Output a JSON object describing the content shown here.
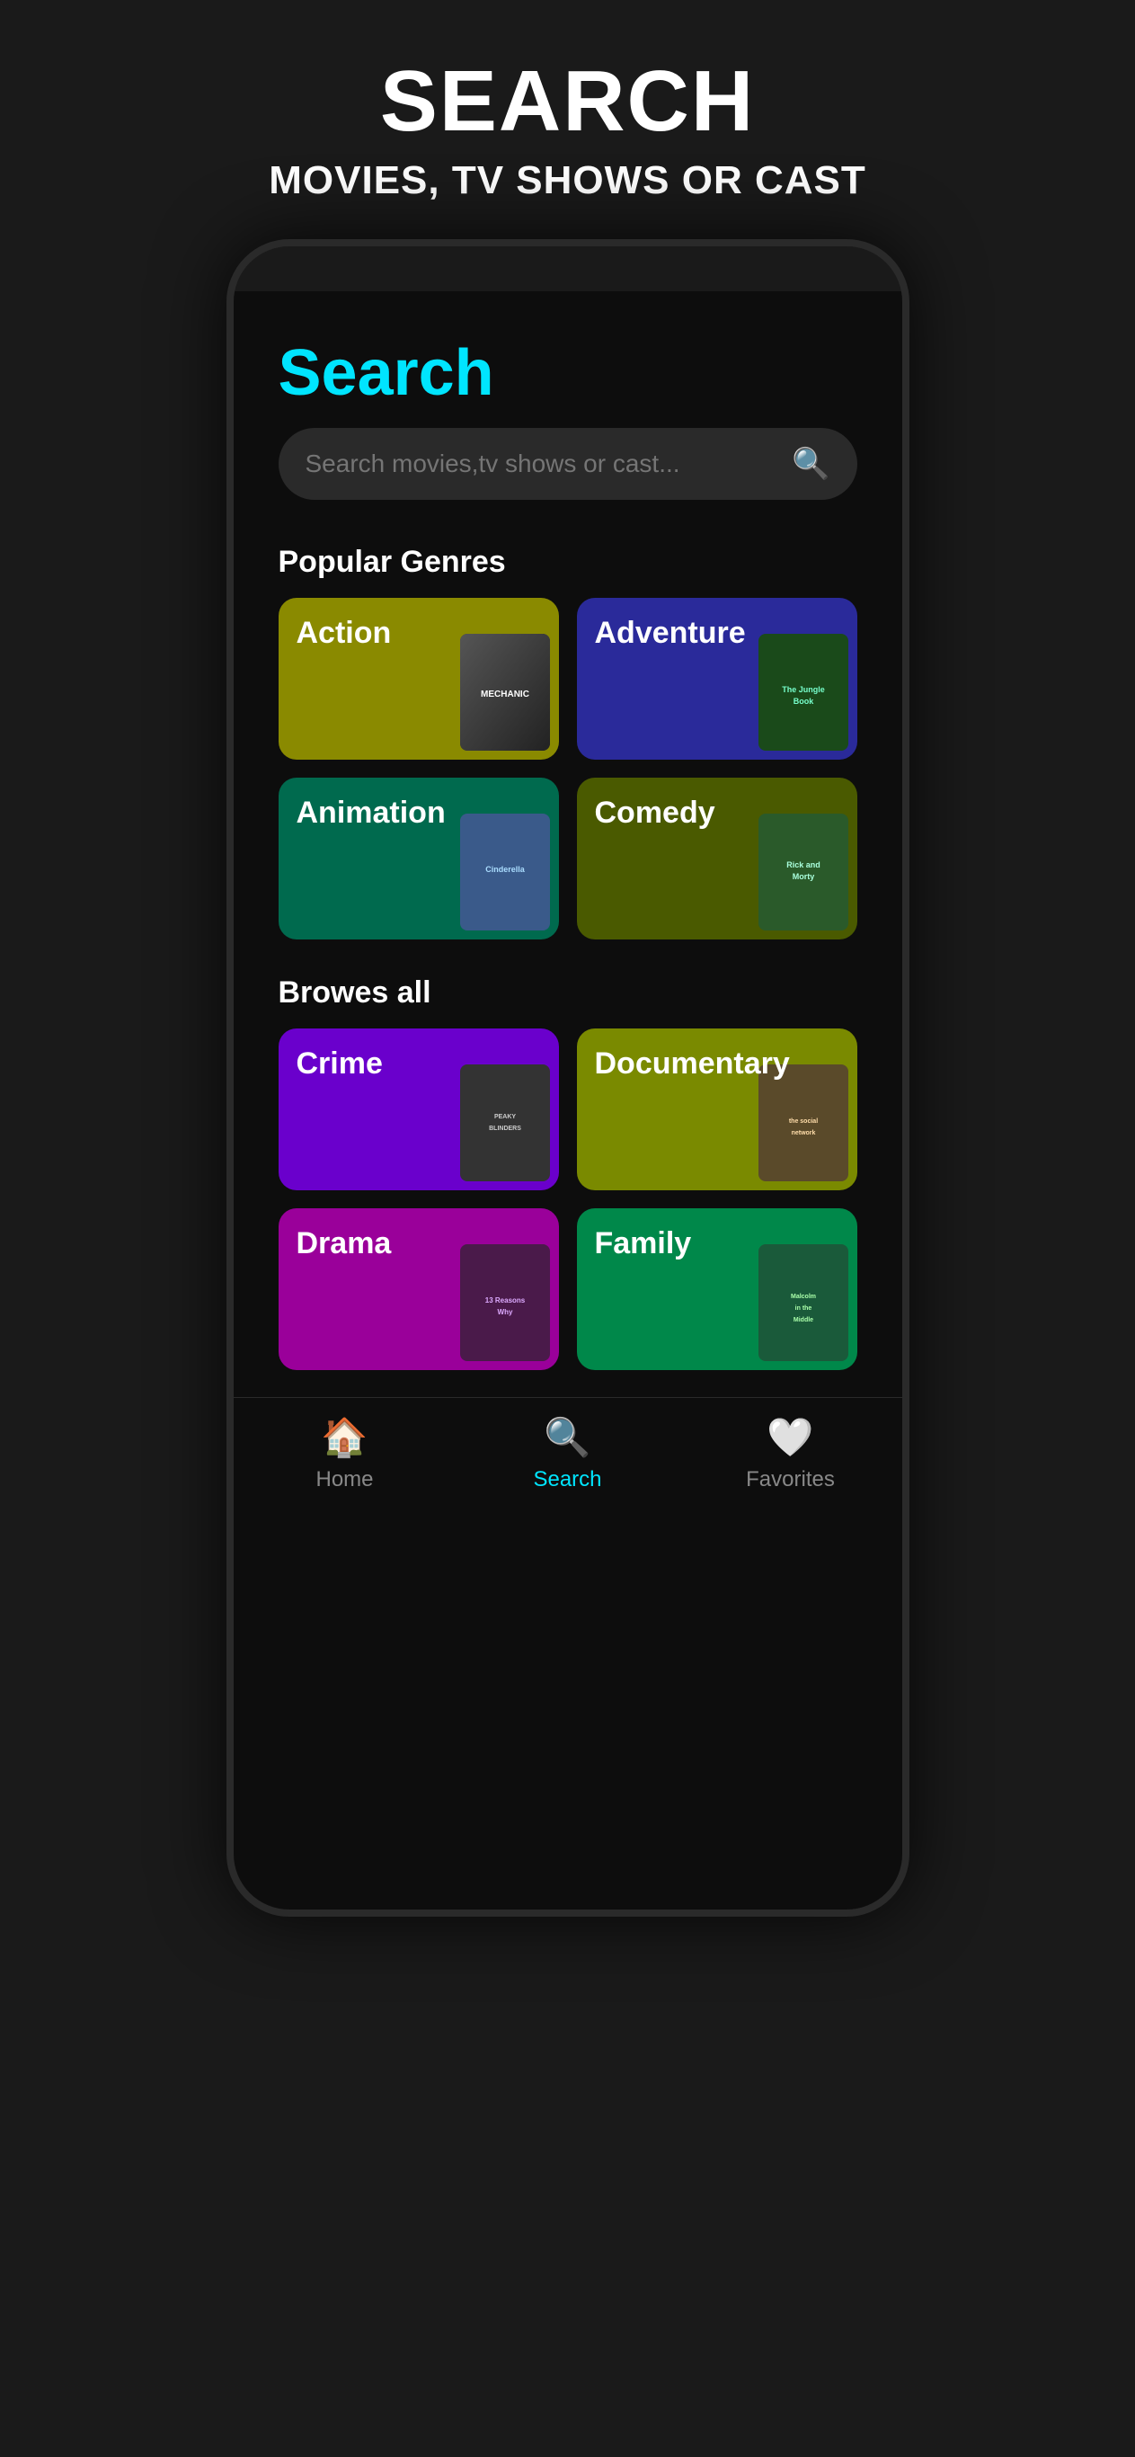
{
  "header": {
    "title": "SEARCH",
    "subtitle": "MOVIES, TV SHOWS OR CAST"
  },
  "screen": {
    "search_title": "Search",
    "search_placeholder": "Search movies,tv shows or cast...",
    "popular_genres_label": "Popular Genres",
    "browse_all_label": "Browes all",
    "genres_popular": [
      {
        "id": "action",
        "label": "Action",
        "color": "genre-action",
        "cover": "mechanic"
      },
      {
        "id": "adventure",
        "label": "Adventure",
        "color": "genre-adventure",
        "cover": "jungle"
      },
      {
        "id": "animation",
        "label": "Animation",
        "color": "genre-animation",
        "cover": "cinderella"
      },
      {
        "id": "comedy",
        "label": "Comedy",
        "color": "genre-comedy",
        "cover": "rick"
      }
    ],
    "genres_all": [
      {
        "id": "crime",
        "label": "Crime",
        "color": "genre-crime",
        "cover": "peaky"
      },
      {
        "id": "documentary",
        "label": "Documentary",
        "color": "genre-documentary",
        "cover": "social"
      },
      {
        "id": "drama",
        "label": "Drama",
        "color": "genre-drama",
        "cover": "drama-show"
      },
      {
        "id": "family",
        "label": "Family",
        "color": "genre-family",
        "cover": "malcolm"
      }
    ]
  },
  "nav": {
    "items": [
      {
        "id": "home",
        "label": "Home",
        "icon": "🏠",
        "active": false
      },
      {
        "id": "search",
        "label": "Search",
        "icon": "🔍",
        "active": true
      },
      {
        "id": "favorites",
        "label": "Favorites",
        "icon": "🤍",
        "active": false
      }
    ]
  }
}
